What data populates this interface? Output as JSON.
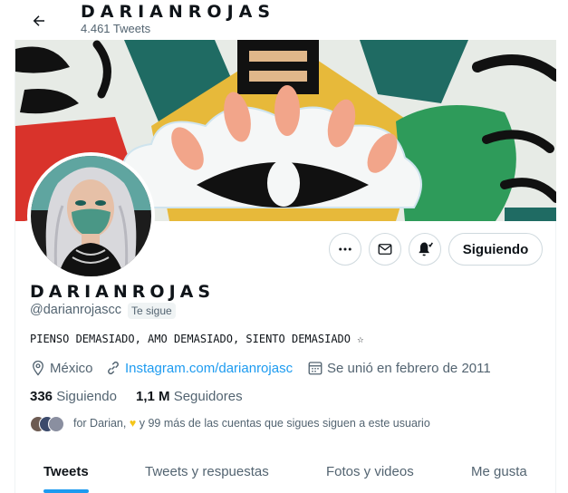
{
  "header": {
    "back_label": "Back",
    "name": "DARIANROJAS",
    "tweet_count": "4.461 Tweets"
  },
  "profile": {
    "display_name": "DARIANROJAS",
    "handle": "@darianrojascc",
    "follows_you_badge": "Te sigue",
    "bio": "PIENSO DEMASIADO, AMO DEMASIADO, SIENTO DEMASIADO ☆",
    "location": "México",
    "website": "Instagram.com/darianrojasc",
    "joined": "Se unió en febrero de 2011",
    "following_count": "336",
    "following_label": "Siguiendo",
    "followers_count": "1,1 M",
    "followers_label": "Seguidores",
    "mutual_text_pre": "for Darian,",
    "mutual_text_post": "y 99 más de las cuentas que sigues siguen a este usuario"
  },
  "actions": {
    "more_icon": "more-icon",
    "message_icon": "mail-icon",
    "notify_icon": "bell-icon",
    "follow_button": "Siguiendo"
  },
  "tabs": [
    {
      "label": "Tweets",
      "active": true
    },
    {
      "label": "Tweets y respuestas",
      "active": false
    },
    {
      "label": "Fotos y videos",
      "active": false
    },
    {
      "label": "Me gusta",
      "active": false
    }
  ],
  "colors": {
    "accent": "#1d9bf0",
    "text": "#0f1419",
    "secondary": "#536471",
    "border": "#cfd9de"
  }
}
